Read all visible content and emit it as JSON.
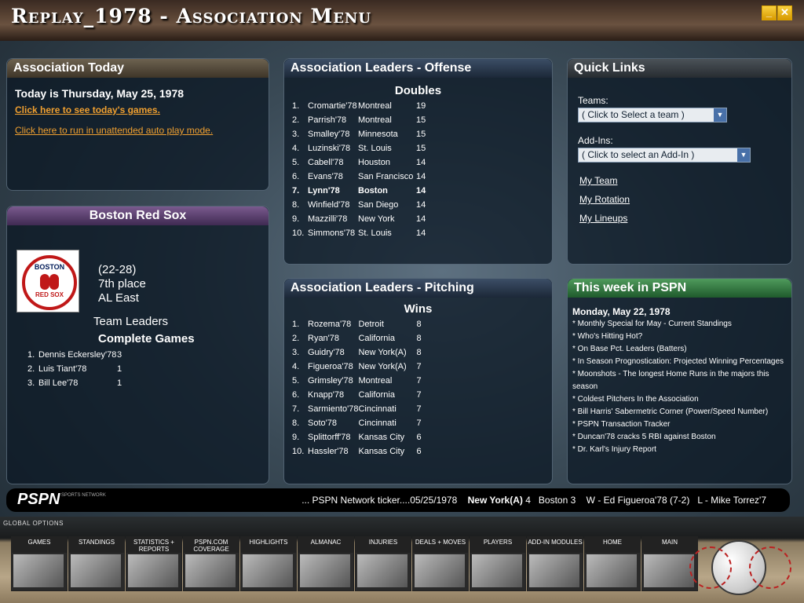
{
  "window": {
    "title": "Replay_1978 - Association Menu",
    "min_btn": "_",
    "close_btn": "✕"
  },
  "association_today": {
    "header": "Association Today",
    "today": "Today is Thursday, May 25, 1978",
    "link_games": "Click here to see today's games.",
    "link_auto": "Click here to run in unattended auto play mode."
  },
  "team": {
    "header": "Boston Red Sox",
    "logo_top": "BOSTON",
    "logo_bottom": "RED SOX",
    "record": "(22-28)",
    "place": "7th place",
    "division": "AL East",
    "leaders_label": "Team Leaders",
    "category": "Complete Games",
    "leaders": [
      {
        "rank": "1.",
        "name": "Dennis Eckersley'78",
        "value": "3"
      },
      {
        "rank": "2.",
        "name": "Luis Tiant'78",
        "value": "1"
      },
      {
        "rank": "3.",
        "name": "Bill Lee'78",
        "value": "1"
      }
    ]
  },
  "offense": {
    "header": "Association Leaders - Offense",
    "category": "Doubles",
    "rows": [
      {
        "rank": "1.",
        "name": "Cromartie'78",
        "team": "Montreal",
        "value": "19"
      },
      {
        "rank": "2.",
        "name": "Parrish'78",
        "team": "Montreal",
        "value": "15"
      },
      {
        "rank": "3.",
        "name": "Smalley'78",
        "team": "Minnesota",
        "value": "15"
      },
      {
        "rank": "4.",
        "name": "Luzinski'78",
        "team": "St. Louis",
        "value": "15"
      },
      {
        "rank": "5.",
        "name": "Cabell'78",
        "team": "Houston",
        "value": "14"
      },
      {
        "rank": "6.",
        "name": "Evans'78",
        "team": "San Francisco",
        "value": "14"
      },
      {
        "rank": "7.",
        "name": "Lynn'78",
        "team": "Boston",
        "value": "14"
      },
      {
        "rank": "8.",
        "name": "Winfield'78",
        "team": "San Diego",
        "value": "14"
      },
      {
        "rank": "9.",
        "name": "Mazzilli'78",
        "team": "New York",
        "value": "14"
      },
      {
        "rank": "10.",
        "name": "Simmons'78",
        "team": "St. Louis",
        "value": "14"
      }
    ]
  },
  "pitching": {
    "header": "Association Leaders - Pitching",
    "category": "Wins",
    "rows": [
      {
        "rank": "1.",
        "name": "Rozema'78",
        "team": "Detroit",
        "value": "8"
      },
      {
        "rank": "2.",
        "name": "Ryan'78",
        "team": "California",
        "value": "8"
      },
      {
        "rank": "3.",
        "name": "Guidry'78",
        "team": "New York(A)",
        "value": "8"
      },
      {
        "rank": "4.",
        "name": "Figueroa'78",
        "team": "New York(A)",
        "value": "7"
      },
      {
        "rank": "5.",
        "name": "Grimsley'78",
        "team": "Montreal",
        "value": "7"
      },
      {
        "rank": "6.",
        "name": "Knapp'78",
        "team": "California",
        "value": "7"
      },
      {
        "rank": "7.",
        "name": "Sarmiento'78",
        "team": "Cincinnati",
        "value": "7"
      },
      {
        "rank": "8.",
        "name": "Soto'78",
        "team": "Cincinnati",
        "value": "7"
      },
      {
        "rank": "9.",
        "name": "Splittorff'78",
        "team": "Kansas City",
        "value": "6"
      },
      {
        "rank": "10.",
        "name": "Hassler'78",
        "team": "Kansas City",
        "value": "6"
      }
    ]
  },
  "quick_links": {
    "header": "Quick Links",
    "teams_label": "Teams:",
    "teams_select": "( Click to Select a team )",
    "addins_label": "Add-Ins:",
    "addins_select": "( Click to select an Add-In )",
    "links": [
      "My Team",
      "My Rotation",
      "My Lineups"
    ]
  },
  "pspn": {
    "header": "This week in PSPN",
    "date": "Monday, May 22, 1978",
    "items": [
      "* Monthly Special for May - Current Standings",
      "* Who's Hitting Hot?",
      "* On Base Pct. Leaders (Batters)",
      "* In Season Prognostication: Projected Winning Percentages",
      "* Moonshots - The longest Home Runs in the majors this season",
      "* Coldest Pitchers In the Association",
      "* Bill Harris' Sabermetric Corner (Power/Speed Number)",
      "* PSPN Transaction Tracker",
      "* Duncan'78 cracks 5 RBI against Boston",
      "* Dr. Karl's Injury Report"
    ]
  },
  "ticker": {
    "logo": "PSPN",
    "logo_sub": "SPORTS NETWORK",
    "lead": "... PSPN Network ticker....05/25/1978",
    "team1": "New York(A)",
    "score1": "4",
    "team2": "Boston",
    "score2": "3",
    "winner": "W - Ed Figueroa'78 (7-2)",
    "loser": "L - Mike Torrez'7"
  },
  "global": {
    "label": "GLOBAL OPTIONS",
    "buttons": [
      "GAMES",
      "STANDINGS",
      "STATISTICS + REPORTS",
      "PSPN.COM COVERAGE",
      "HIGHLIGHTS",
      "ALMANAC",
      "INJURIES",
      "DEALS + MOVES",
      "PLAYERS",
      "ADD-IN MODULES",
      "HOME",
      "MAIN"
    ]
  },
  "colors": {
    "link": "#f0a030",
    "panel_bg": "#0a1622",
    "green_header": "#4f9a5c",
    "purple_header": "#7a5a8e"
  }
}
